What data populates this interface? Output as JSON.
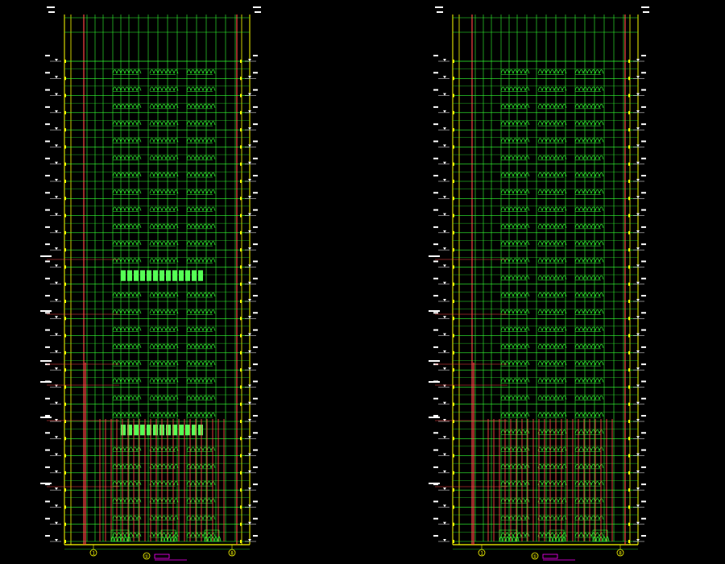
{
  "application": {
    "view": "CAD model space",
    "background_color": "#000000"
  },
  "colors": {
    "grid": "#33ff33",
    "column": "#ff4444",
    "frame": "#ffff00",
    "window": "#33ff33",
    "highlight": "#55ff55",
    "annotation": "#ffffff",
    "axis_label": "#ff00ff"
  },
  "elevations": [
    {
      "id": "left-elevation",
      "floors": 28,
      "bands": [
        12,
        21
      ],
      "axis_bubbles": [
        "1",
        "8"
      ],
      "title_bubble": "①"
    },
    {
      "id": "right-elevation",
      "floors": 28,
      "bands": [],
      "axis_bubbles": [
        "1",
        "8"
      ],
      "title_bubble": "①"
    }
  ]
}
